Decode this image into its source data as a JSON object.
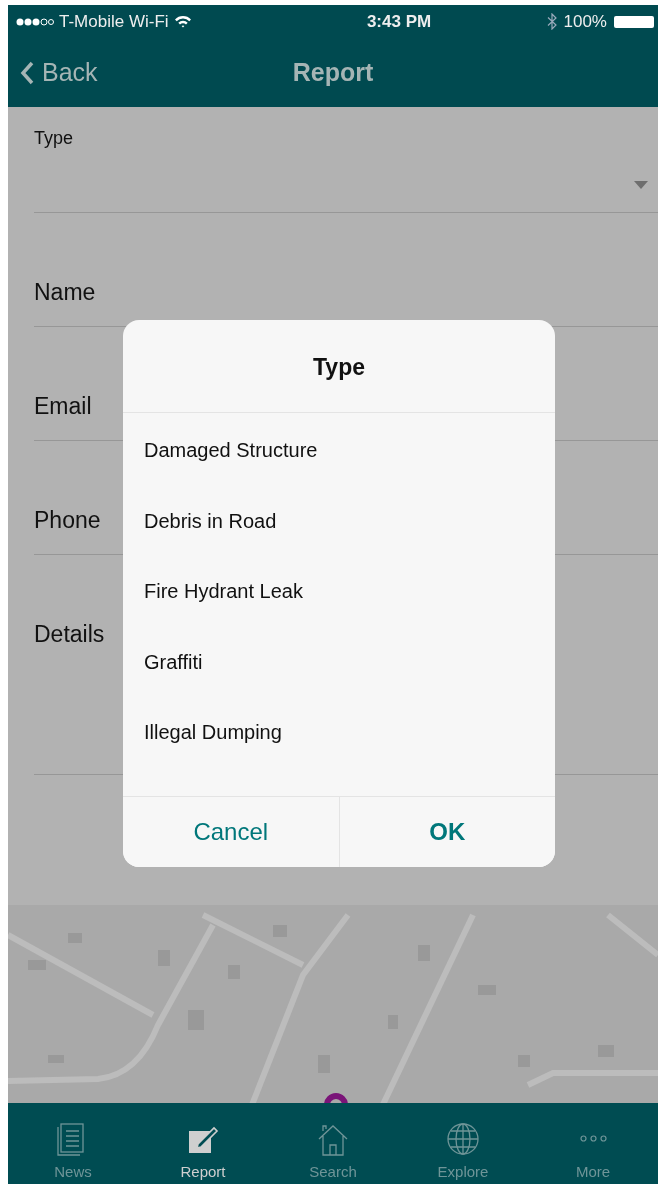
{
  "status_bar": {
    "carrier": "T-Mobile Wi-Fi",
    "time": "3:43 PM",
    "battery": "100%"
  },
  "nav_bar": {
    "back": "Back",
    "title": "Report"
  },
  "form": {
    "fields": [
      {
        "kind": "select",
        "label": "Type"
      },
      {
        "kind": "text",
        "label": "Name"
      },
      {
        "kind": "text",
        "label": "Email"
      },
      {
        "kind": "text",
        "label": "Phone"
      },
      {
        "kind": "textarea",
        "label": "Details"
      }
    ]
  },
  "dialog": {
    "title": "Type",
    "options": [
      {
        "label": "Damaged Structure"
      },
      {
        "label": "Debris in Road"
      },
      {
        "label": "Fire Hydrant Leak"
      },
      {
        "label": "Graffiti"
      },
      {
        "label": "Illegal Dumping"
      }
    ],
    "buttons": [
      {
        "kind": "cancel",
        "label": "Cancel"
      },
      {
        "kind": "ok",
        "label": "OK"
      }
    ]
  },
  "tab_bar": {
    "tabs": [
      {
        "kind": "news",
        "label": "News",
        "selected": false
      },
      {
        "kind": "report",
        "label": "Report",
        "selected": true
      },
      {
        "kind": "search",
        "label": "Search",
        "selected": false
      },
      {
        "kind": "explore",
        "label": "Explore",
        "selected": false
      },
      {
        "kind": "more",
        "label": "More",
        "selected": false
      }
    ]
  }
}
